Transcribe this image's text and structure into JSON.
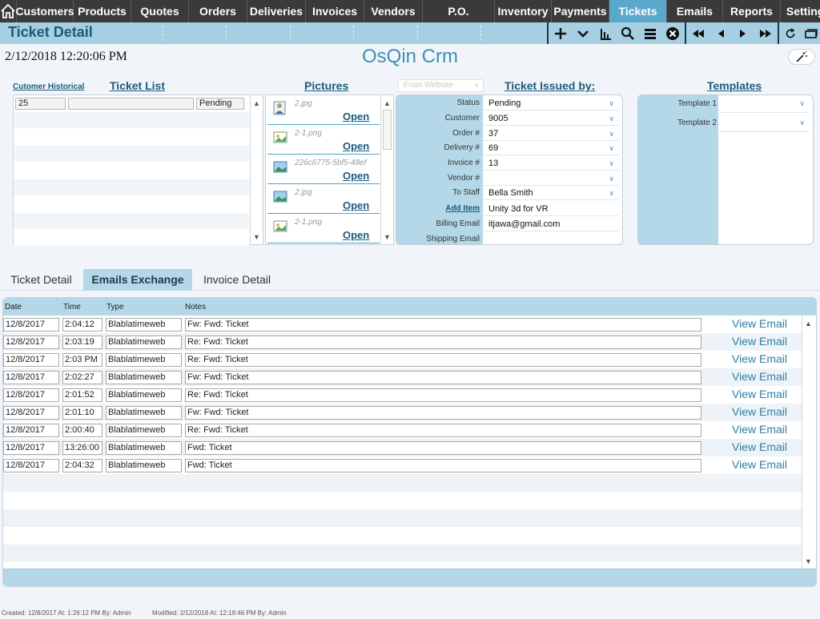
{
  "nav": [
    "Customers",
    "Products",
    "Quotes",
    "Orders",
    "Deliveries",
    "Invoices",
    "Vendors",
    "P.O.",
    "Inventory",
    "Payments",
    "Tickets",
    "Emails",
    "Reports",
    "Settings"
  ],
  "nav_active": "Tickets",
  "page_title": "Ticket Detail",
  "datetime": "2/12/2018 12:20:06 PM",
  "app_name": "OsQin Crm",
  "ticket_list": {
    "historical_link": "Cutomer Historical",
    "heading": "Ticket List",
    "rows": [
      {
        "id": "25",
        "desc": "",
        "status": "Pending"
      }
    ]
  },
  "pictures": {
    "heading": "Pictures",
    "open_label": "Open",
    "items": [
      {
        "file": "2.jpg",
        "icon": "person-image-icon"
      },
      {
        "file": "2-1.png",
        "icon": "image-file-icon"
      },
      {
        "file": "226c6775-5bf5-48ef",
        "icon": "landscape-image-icon"
      },
      {
        "file": "2.jpg",
        "icon": "landscape-image-icon"
      },
      {
        "file": "2-1.png",
        "icon": "image-file-icon"
      }
    ]
  },
  "from_website": "From Website",
  "issued": {
    "heading": "Ticket Issued by:",
    "fields": [
      {
        "label": "Status",
        "value": "Pending",
        "dropdown": true
      },
      {
        "label": "Customer",
        "value": "9005",
        "dropdown": true
      },
      {
        "label": "Order #",
        "value": "37",
        "dropdown": true
      },
      {
        "label": "Delivery #",
        "value": "69",
        "dropdown": true
      },
      {
        "label": "Invoice #",
        "value": "13",
        "dropdown": true
      },
      {
        "label": "Vendor #",
        "value": "",
        "dropdown": true
      },
      {
        "label": "To Staff",
        "value": "Bella Smith",
        "dropdown": true
      },
      {
        "label": "Add Item",
        "value": "Unity 3d for VR",
        "dropdown": false
      },
      {
        "label": "Billing Email",
        "value": "itjawa@gmail.com",
        "dropdown": false
      },
      {
        "label": "Shipping Email",
        "value": "",
        "dropdown": false
      }
    ]
  },
  "templates": {
    "heading": "Templates",
    "fields": [
      {
        "label": "Template 1",
        "value": ""
      },
      {
        "label": "Template 2",
        "value": ""
      }
    ]
  },
  "tabs": [
    "Ticket Detail",
    "Emails Exchange",
    "Invoice Detail"
  ],
  "active_tab": "Emails Exchange",
  "emails": {
    "columns": [
      "Date",
      "Time",
      "Type",
      "Notes"
    ],
    "view_label": "View Email",
    "rows": [
      {
        "date": "12/8/2017",
        "time": "2:04:12",
        "type": "Blablatimeweb",
        "notes": "Fw: Fwd: Ticket"
      },
      {
        "date": "12/8/2017",
        "time": "2:03:19",
        "type": "Blablatimeweb",
        "notes": "Re: Fwd: Ticket"
      },
      {
        "date": "12/8/2017",
        "time": "2:03 PM",
        "type": "Blablatimeweb",
        "notes": "Re: Fwd: Ticket"
      },
      {
        "date": "12/8/2017",
        "time": "2:02:27",
        "type": "Blablatimeweb",
        "notes": "Fw: Fwd: Ticket"
      },
      {
        "date": "12/8/2017",
        "time": "2:01:52",
        "type": "Blablatimeweb",
        "notes": "Re: Fwd: Ticket"
      },
      {
        "date": "12/8/2017",
        "time": "2:01:10",
        "type": "Blablatimeweb",
        "notes": "Fw: Fwd: Ticket"
      },
      {
        "date": "12/8/2017",
        "time": "2:00:40",
        "type": "Blablatimeweb",
        "notes": "Re: Fwd: Ticket"
      },
      {
        "date": "12/8/2017",
        "time": "13:26:00",
        "type": "Blablatimeweb",
        "notes": "Fwd: Ticket"
      },
      {
        "date": "12/8/2017",
        "time": "2:04:32",
        "type": "Blablatimeweb",
        "notes": "Fwd: Ticket"
      }
    ]
  },
  "footer": {
    "created": "Created: 12/8/2017   At:  1:26:12 PM  By: Admin",
    "modified": "Modified: 2/12/2018   At:  12:19:46 PM  By: Admin"
  },
  "colors": {
    "accent": "#5aa9cc",
    "title_bar": "#a6cfe2",
    "heading": "#1c5a7c",
    "nav_bg": "#3a3a3a"
  }
}
